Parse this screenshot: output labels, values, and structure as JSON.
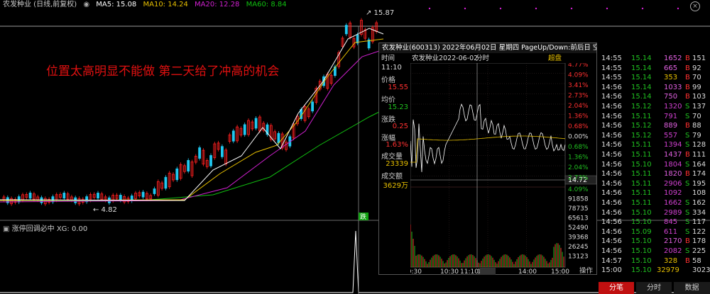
{
  "header": {
    "title": "农发种业 (日线,前复权)",
    "ma5": "MA5: 15.08",
    "ma10": "MA10: 14.24",
    "ma20": "MA20: 12.28",
    "ma60": "MA60: 8.84",
    "colors": {
      "ma5": "#ffffff",
      "ma10": "#e8c000",
      "ma20": "#d020d0",
      "ma60": "#10c010"
    }
  },
  "chart": {
    "high_label": "15.87",
    "low_label": "4.82",
    "annotation": "位置太高明显不能做 第二天给了冲高的机会",
    "marker": "跌",
    "up_color": "#ff2020",
    "down_color": "#20c8f0"
  },
  "indicator": {
    "label": "涨停回调必中 XG: 0.00"
  },
  "popup": {
    "title": "农发种业(600313)  2022年06月02日 星期四  PageUp/Down:前后日  空格键:操作",
    "sub_time_label": "时间",
    "sub_name": "农发种业",
    "sub_date": "2022-06-02",
    "sub_mode": "分时",
    "sub_right": "超盘",
    "time_value": "11:10",
    "price_label": "价格",
    "price_value": "15.55",
    "avg_label": "均价",
    "avg_value": "15.23",
    "change_label": "涨跌",
    "change_value": "0.25",
    "pct_label": "涨幅",
    "pct_value": "1.63%",
    "vol_label": "成交量",
    "vol_value": "23339",
    "amt_label": "成交额",
    "amt_value": "3629万",
    "cursor_price": "14.72",
    "right_axis": [
      "4.77%",
      "4.09%",
      "3.41%",
      "2.73%",
      "2.04%",
      "1.36%",
      "0.68%",
      "0.00%",
      "0.68%",
      "1.36%",
      "2.04%",
      "2.73%"
    ],
    "vol_axis": [
      "4.09%",
      "91858",
      "78735",
      "65613",
      "52490",
      "39368",
      "26245",
      "13123"
    ],
    "time_axis": [
      "09:30",
      "10:30",
      "11:10",
      "13:00",
      "14:00",
      "15:00"
    ],
    "operate_label": "操作"
  },
  "trades": [
    {
      "t": "14:55",
      "p": "15.14",
      "v": "1652",
      "s": "B",
      "n": "151"
    },
    {
      "t": "14:55",
      "p": "15.14",
      "v": "665",
      "s": "B",
      "n": "92"
    },
    {
      "t": "14:55",
      "p": "15.14",
      "v": "353",
      "s": "B",
      "n": "70"
    },
    {
      "t": "14:56",
      "p": "15.14",
      "v": "1033",
      "s": "B",
      "n": "99"
    },
    {
      "t": "14:56",
      "p": "15.14",
      "v": "750",
      "s": "B",
      "n": "103"
    },
    {
      "t": "14:56",
      "p": "15.12",
      "v": "1320",
      "s": "S",
      "n": "137"
    },
    {
      "t": "14:56",
      "p": "15.11",
      "v": "791",
      "s": "S",
      "n": "70"
    },
    {
      "t": "14:56",
      "p": "15.12",
      "v": "889",
      "s": "B",
      "n": "88"
    },
    {
      "t": "14:56",
      "p": "15.12",
      "v": "557",
      "s": "S",
      "n": "79"
    },
    {
      "t": "14:56",
      "p": "15.11",
      "v": "1394",
      "s": "S",
      "n": "128"
    },
    {
      "t": "14:56",
      "p": "15.11",
      "v": "1437",
      "s": "B",
      "n": "111"
    },
    {
      "t": "14:56",
      "p": "15.10",
      "v": "1804",
      "s": "S",
      "n": "164"
    },
    {
      "t": "14:56",
      "p": "15.11",
      "v": "1820",
      "s": "B",
      "n": "174"
    },
    {
      "t": "14:56",
      "p": "15.11",
      "v": "2906",
      "s": "S",
      "n": "195"
    },
    {
      "t": "14:56",
      "p": "15.11",
      "v": "1092",
      "s": "",
      "n": "108"
    },
    {
      "t": "14:56",
      "p": "15.11",
      "v": "1662",
      "s": "S",
      "n": "162"
    },
    {
      "t": "14:56",
      "p": "15.10",
      "v": "2989",
      "s": "S",
      "n": "334"
    },
    {
      "t": "14:56",
      "p": "15.10",
      "v": "845",
      "s": "S",
      "n": "117"
    },
    {
      "t": "14:56",
      "p": "15.09",
      "v": "611",
      "s": "S",
      "n": "122"
    },
    {
      "t": "14:56",
      "p": "15.10",
      "v": "2170",
      "s": "B",
      "n": "178"
    },
    {
      "t": "14:56",
      "p": "15.10",
      "v": "2082",
      "s": "S",
      "n": "225"
    },
    {
      "t": "14:57",
      "p": "15.10",
      "v": "328",
      "s": "B",
      "n": "58"
    },
    {
      "t": "15:00",
      "p": "15.10",
      "v": "32979",
      "s": "",
      "n": "3023"
    }
  ],
  "tabs": [
    {
      "label": "分笔",
      "active": true
    },
    {
      "label": "分时",
      "active": false
    },
    {
      "label": "数据",
      "active": false
    }
  ]
}
